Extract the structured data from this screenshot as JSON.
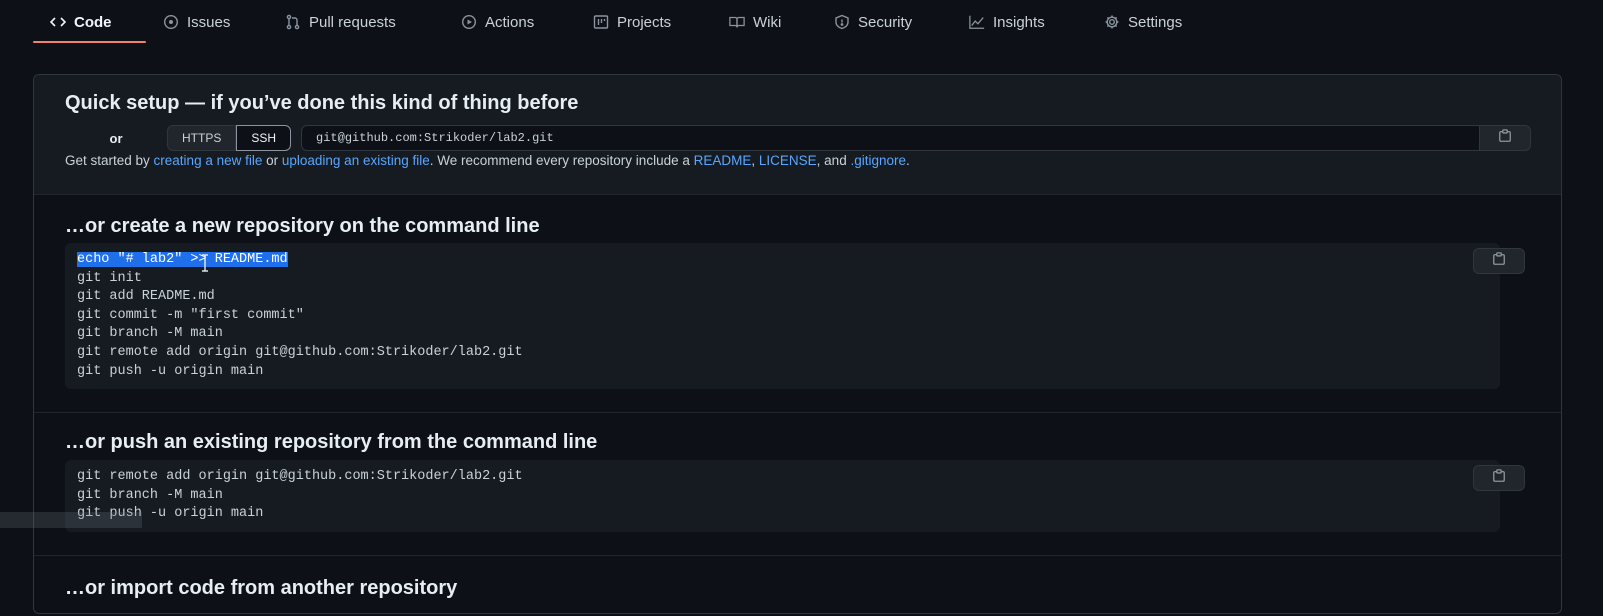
{
  "nav": {
    "tabs": [
      {
        "label": "Code",
        "icon": "code-icon"
      },
      {
        "label": "Issues",
        "icon": "issue-icon"
      },
      {
        "label": "Pull requests",
        "icon": "pull-request-icon"
      },
      {
        "label": "Actions",
        "icon": "play-icon"
      },
      {
        "label": "Projects",
        "icon": "table-icon"
      },
      {
        "label": "Wiki",
        "icon": "book-icon"
      },
      {
        "label": "Security",
        "icon": "shield-icon"
      },
      {
        "label": "Insights",
        "icon": "graph-icon"
      },
      {
        "label": "Settings",
        "icon": "gear-icon"
      }
    ],
    "active": "Code"
  },
  "quick_setup": {
    "title": "Quick setup — if you’ve done this kind of thing before",
    "or_label": "or",
    "protocols": [
      "HTTPS",
      "SSH"
    ],
    "selected_protocol": "SSH",
    "clone_url": "git@github.com:Strikoder/lab2.git",
    "hint": {
      "prefix": "Get started by ",
      "link1": "creating a new file",
      "mid1": " or ",
      "link2": "uploading an existing file",
      "mid2": ". We recommend every repository include a ",
      "link3": "README",
      "sep1": ", ",
      "link4": "LICENSE",
      "mid3": ", and ",
      "link5": ".gitignore",
      "suffix": "."
    }
  },
  "create_section": {
    "title": "…or create a new repository on the command line",
    "lines": [
      "echo \"# lab2\" >> README.md",
      "git init",
      "git add README.md",
      "git commit -m \"first commit\"",
      "git branch -M main",
      "git remote add origin git@github.com:Strikoder/lab2.git",
      "git push -u origin main"
    ],
    "selected_line_index": 0
  },
  "push_section": {
    "title": "…or push an existing repository from the command line",
    "lines": [
      "git remote add origin git@github.com:Strikoder/lab2.git",
      "git branch -M main",
      "git push -u origin main"
    ]
  },
  "import_section": {
    "title": "…or import code from another repository"
  },
  "colors": {
    "background": "#0d1117",
    "accent_underline": "#f78166",
    "link": "#58a6ff",
    "selection": "#1f6feb"
  }
}
